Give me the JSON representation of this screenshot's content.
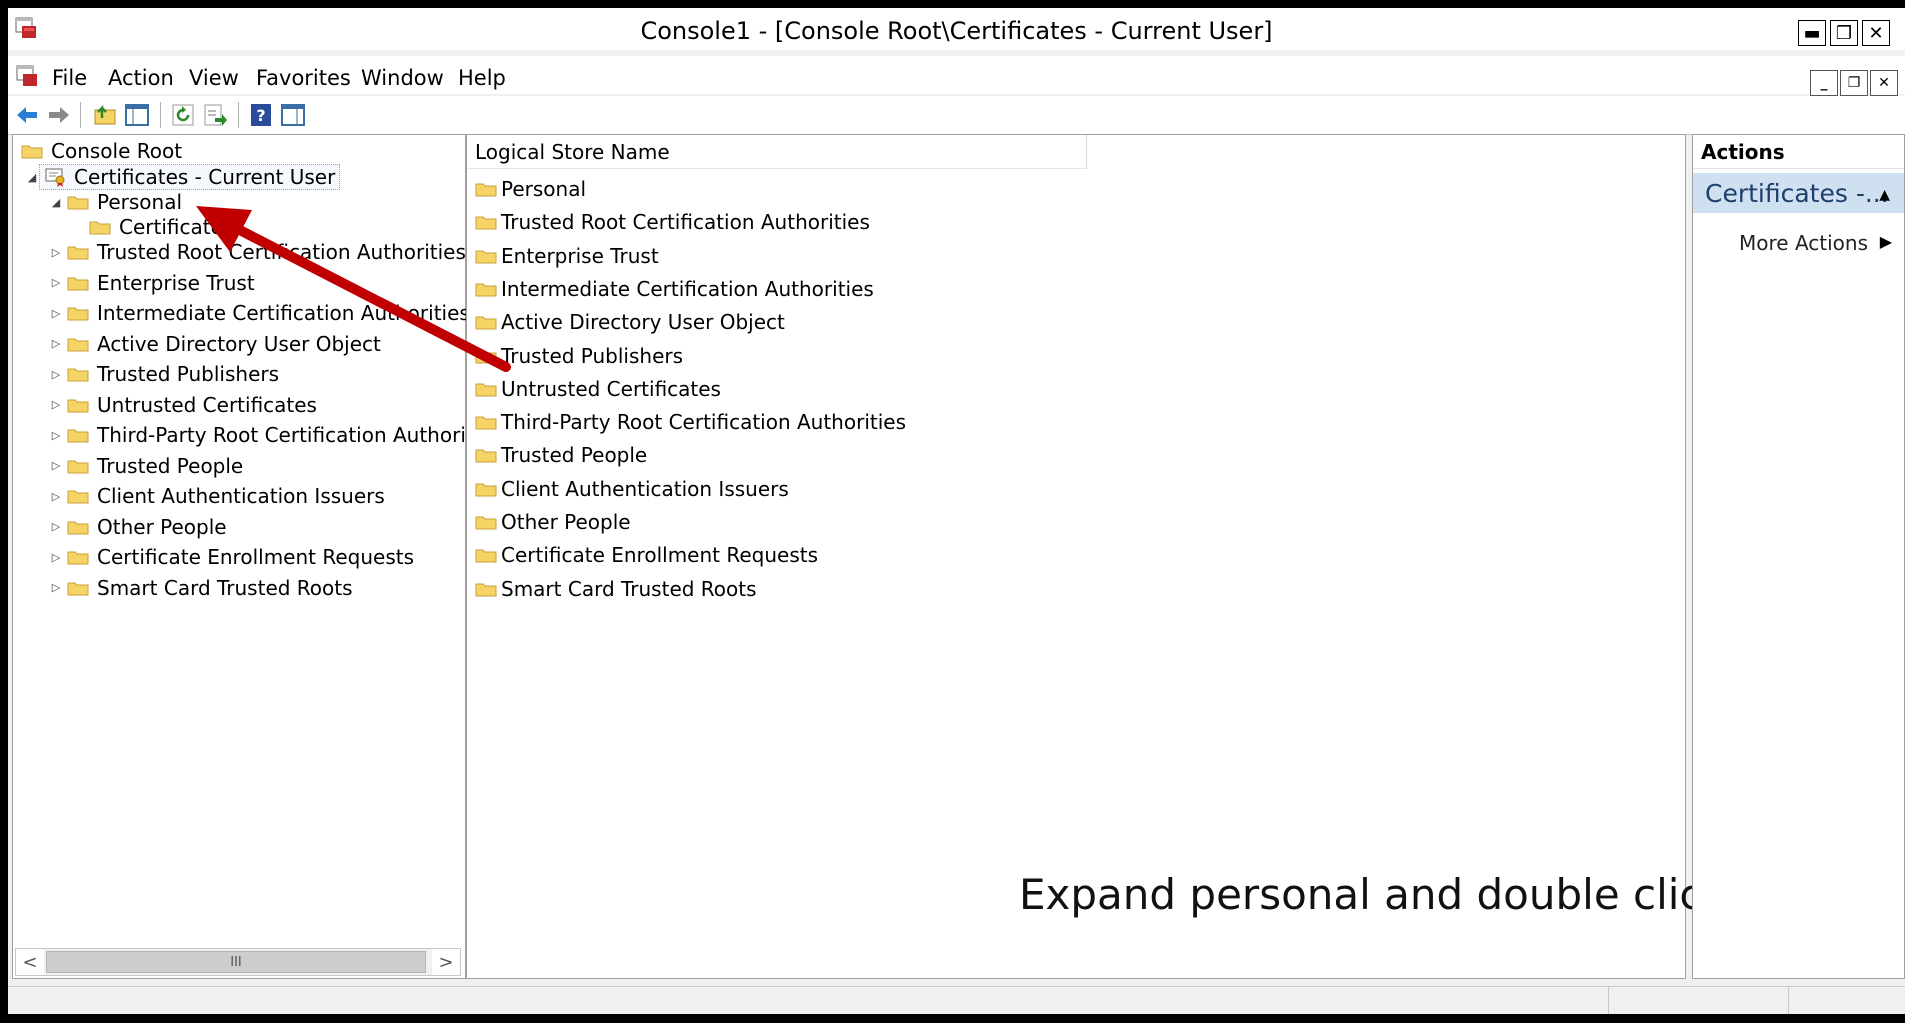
{
  "window": {
    "title": "Console1 - [Console Root\\Certificates - Current User]"
  },
  "menu": [
    "File",
    "Action",
    "View",
    "Favorites",
    "Window",
    "Help"
  ],
  "tree": {
    "root": "Console Root",
    "snapin": "Certificates - Current User",
    "personal": "Personal",
    "personal_child": "Certificates",
    "items": [
      "Trusted Root Certification Authorities",
      "Enterprise Trust",
      "Intermediate Certification Authorities",
      "Active Directory User Object",
      "Trusted Publishers",
      "Untrusted Certificates",
      "Third-Party Root Certification Authorities",
      "Trusted People",
      "Client Authentication Issuers",
      "Other People",
      "Certificate Enrollment Requests",
      "Smart Card Trusted Roots"
    ],
    "scroll_thumb": "III"
  },
  "list": {
    "column": "Logical Store Name",
    "rows": [
      "Personal",
      "Trusted Root Certification Authorities",
      "Enterprise Trust",
      "Intermediate Certification Authorities",
      "Active Directory User Object",
      "Trusted Publishers",
      "Untrusted Certificates",
      "Third-Party Root Certification Authorities",
      "Trusted People",
      "Client Authentication Issuers",
      "Other People",
      "Certificate Enrollment Requests",
      "Smart Card Trusted Roots"
    ]
  },
  "annotation": "Expand personal and double click on certificates",
  "actions": {
    "header": "Actions",
    "section": "Certificates -...",
    "more": "More Actions"
  },
  "colors": {
    "arrow": "#c00000",
    "actions_section_bg": "#cfe0f0",
    "folder": "#f6d365"
  }
}
